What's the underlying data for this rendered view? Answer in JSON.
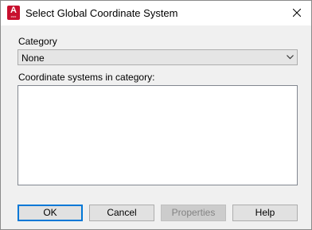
{
  "window": {
    "title": "Select Global Coordinate System",
    "icon": "autocad-app-icon",
    "icon_letter": "A",
    "icon_sub": "2022"
  },
  "category": {
    "label": "Category",
    "selected": "None"
  },
  "systems": {
    "label": "Coordinate systems in category:",
    "items": []
  },
  "buttons": {
    "ok": "OK",
    "cancel": "Cancel",
    "properties": "Properties",
    "help": "Help",
    "properties_disabled": true
  },
  "colors": {
    "accent": "#0078d7",
    "app_icon": "#c8102e"
  }
}
